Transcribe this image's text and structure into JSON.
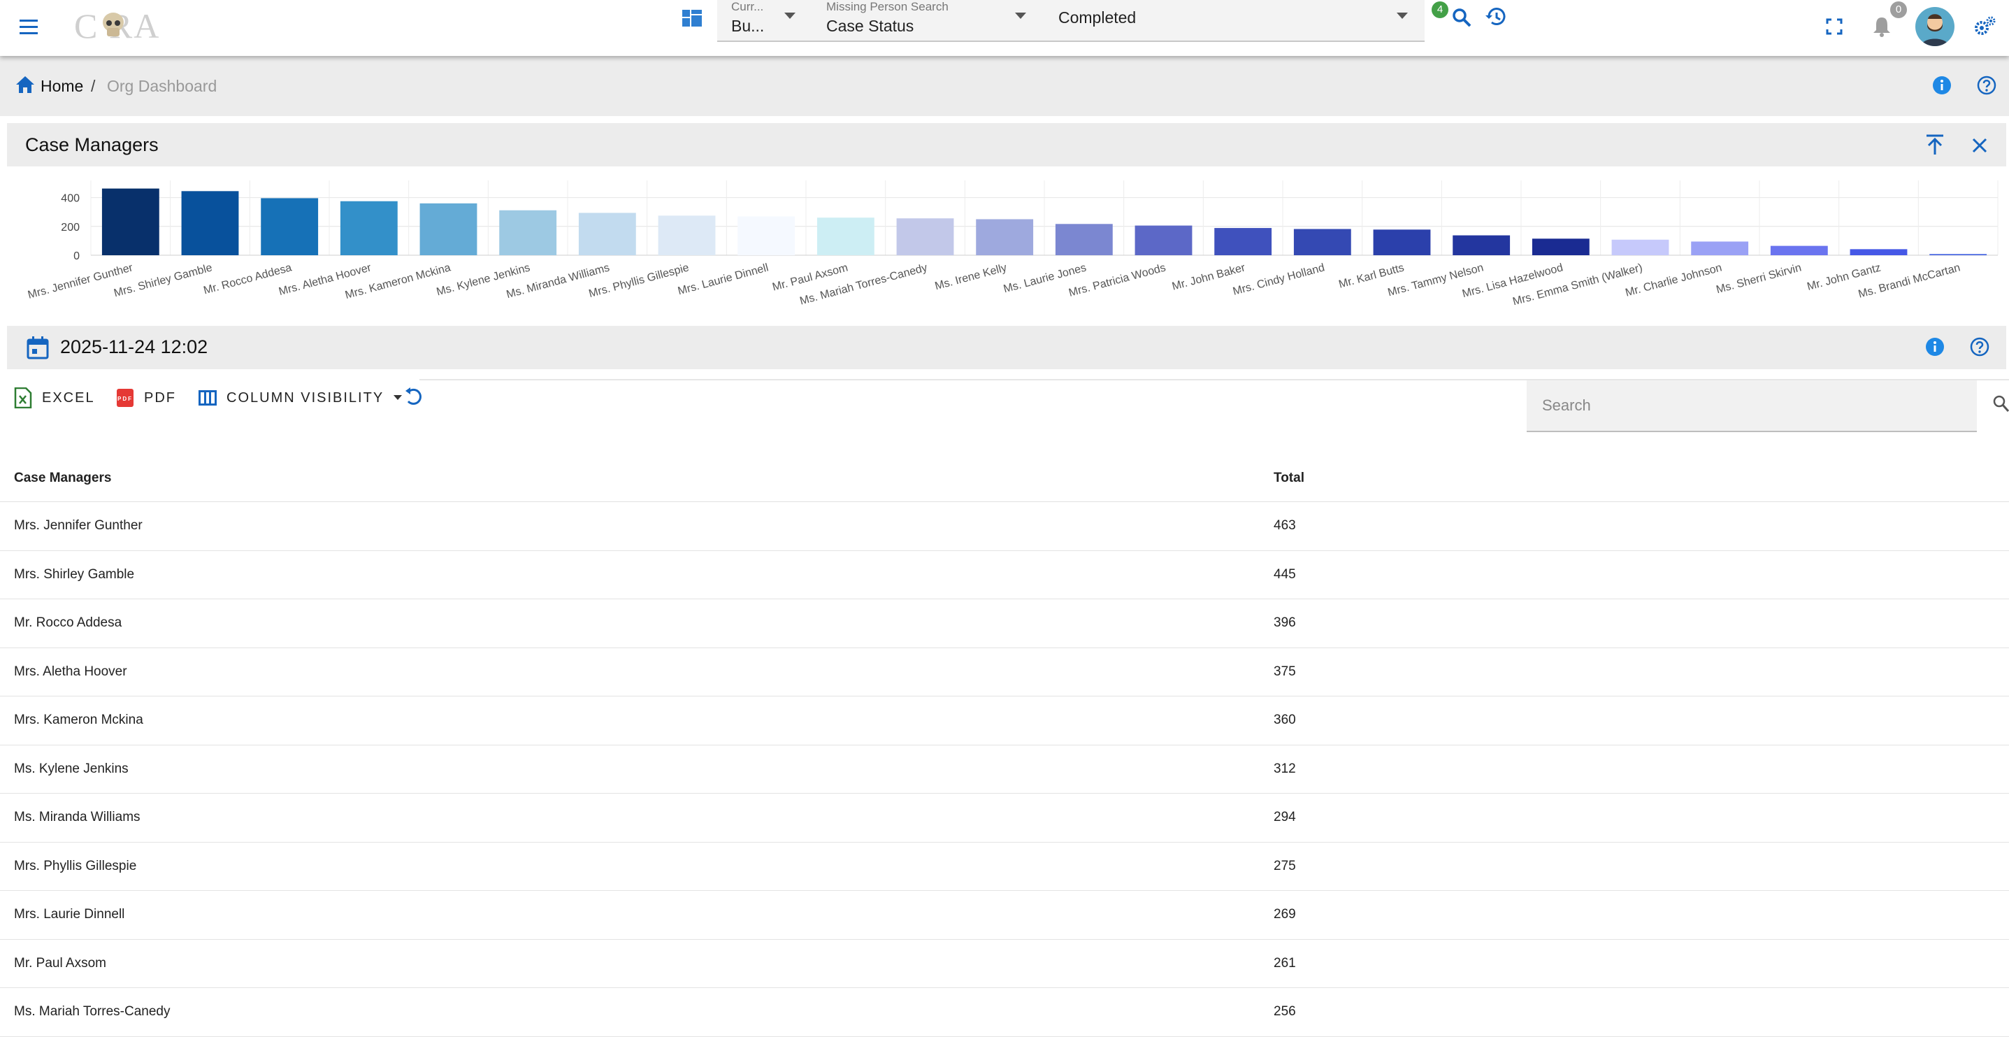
{
  "header": {
    "logo_text": "C   RA",
    "current_label": "Curr...",
    "current_value": "Bu...",
    "search_label": "Missing Person Search",
    "search_value": "Case Status",
    "filter_value": "Completed",
    "filter_badge": "4",
    "notifications_count": "0",
    "icons": [
      "menu-icon",
      "dashboard-icon",
      "search-icon",
      "history-icon",
      "fullscreen-icon",
      "bell-icon",
      "avatar",
      "settings-gears-icon"
    ]
  },
  "breadcrumb": {
    "home": "Home",
    "separator": "/",
    "current": "Org Dashboard"
  },
  "chart_panel": {
    "title": "Case Managers"
  },
  "chart_data": {
    "type": "bar",
    "title": "",
    "xlabel": "",
    "ylabel": "",
    "ylim": [
      0,
      500
    ],
    "yticks": [
      0,
      200,
      400
    ],
    "grid": true,
    "categories": [
      "Mrs. Jennifer Gunther",
      "Mrs. Shirley Gamble",
      "Mr. Rocco Addesa",
      "Mrs. Aletha Hoover",
      "Mrs. Kameron Mckina",
      "Ms. Kylene Jenkins",
      "Ms. Miranda Williams",
      "Mrs. Phyllis Gillespie",
      "Mrs. Laurie Dinnell",
      "Mr. Paul Axsom",
      "Ms. Mariah Torres-Canedy",
      "Ms. Irene Kelly",
      "Ms. Laurie Jones",
      "Mrs. Patricia Woods",
      "Mr. John Baker",
      "Mrs. Cindy Holland",
      "Mr. Karl Butts",
      "Mrs. Tammy Nelson",
      "Mrs. Lisa Hazelwood",
      "Mrs. Emma Smith (Walker)",
      "Mr. Charlie Johnson",
      "Ms. Sherri Skirvin",
      "Mr. John Gantz",
      "Ms. Brandi McCartan"
    ],
    "values": [
      463,
      445,
      396,
      375,
      360,
      312,
      294,
      275,
      269,
      261,
      256,
      250,
      217,
      206,
      189,
      182,
      178,
      138,
      115,
      108,
      95,
      65,
      42,
      8
    ],
    "colors": [
      "#08306b",
      "#08519c",
      "#1671b7",
      "#3390c9",
      "#64abd6",
      "#9dc9e3",
      "#c2dbef",
      "#dde9f6",
      "#f5f9ff",
      "#cdeef4",
      "#c2c8e9",
      "#9ea9de",
      "#7b87d1",
      "#5c68c7",
      "#3f51bd",
      "#3449b3",
      "#2b40ab",
      "#23369f",
      "#1a2b92",
      "#c6c9fb",
      "#9aa1f5",
      "#6a74ef",
      "#4558e6",
      "#3f5fe0"
    ]
  },
  "date_panel": {
    "date": "2025-11-24 12:02"
  },
  "toolbar": {
    "excel": "EXCEL",
    "pdf": "PDF",
    "column_visibility": "COLUMN VISIBILITY",
    "search_placeholder": "Search"
  },
  "table": {
    "headers": [
      "Case Managers",
      "Total"
    ],
    "rows": [
      {
        "name": "Mrs. Jennifer Gunther",
        "total": "463"
      },
      {
        "name": "Mrs. Shirley Gamble",
        "total": "445"
      },
      {
        "name": "Mr. Rocco Addesa",
        "total": "396"
      },
      {
        "name": "Mrs. Aletha Hoover",
        "total": "375"
      },
      {
        "name": "Mrs. Kameron Mckina",
        "total": "360"
      },
      {
        "name": "Ms. Kylene Jenkins",
        "total": "312"
      },
      {
        "name": "Ms. Miranda Williams",
        "total": "294"
      },
      {
        "name": "Mrs. Phyllis Gillespie",
        "total": "275"
      },
      {
        "name": "Mrs. Laurie Dinnell",
        "total": "269"
      },
      {
        "name": "Mr. Paul Axsom",
        "total": "261"
      },
      {
        "name": "Ms. Mariah Torres-Canedy",
        "total": "256"
      }
    ]
  }
}
